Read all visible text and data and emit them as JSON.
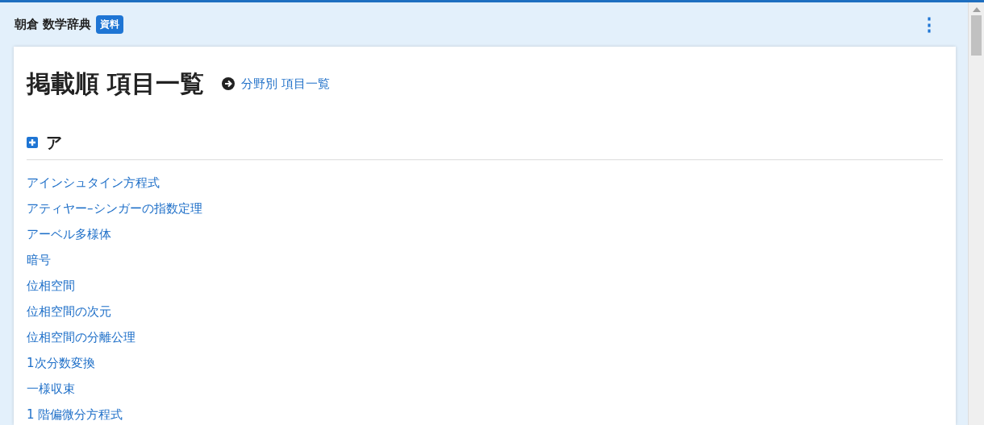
{
  "header": {
    "title": "朝倉 数学辞典",
    "badge": "資料",
    "menu_icon": "⋮"
  },
  "page": {
    "heading": "掲載順 項目一覧",
    "link": "分野別 項目一覧"
  },
  "section": {
    "heading": "ア",
    "items": [
      {
        "label": "アインシュタイン方程式"
      },
      {
        "label": "アティヤー–シンガーの指数定理"
      },
      {
        "label": "アーベル多様体"
      },
      {
        "label": "暗号"
      },
      {
        "label": "位相空間"
      },
      {
        "label": "位相空間の次元"
      },
      {
        "label": "位相空間の分離公理"
      },
      {
        "label": "1次分数変換"
      },
      {
        "label": "一様収束"
      },
      {
        "label": "1 階偏微分方程式"
      }
    ]
  }
}
